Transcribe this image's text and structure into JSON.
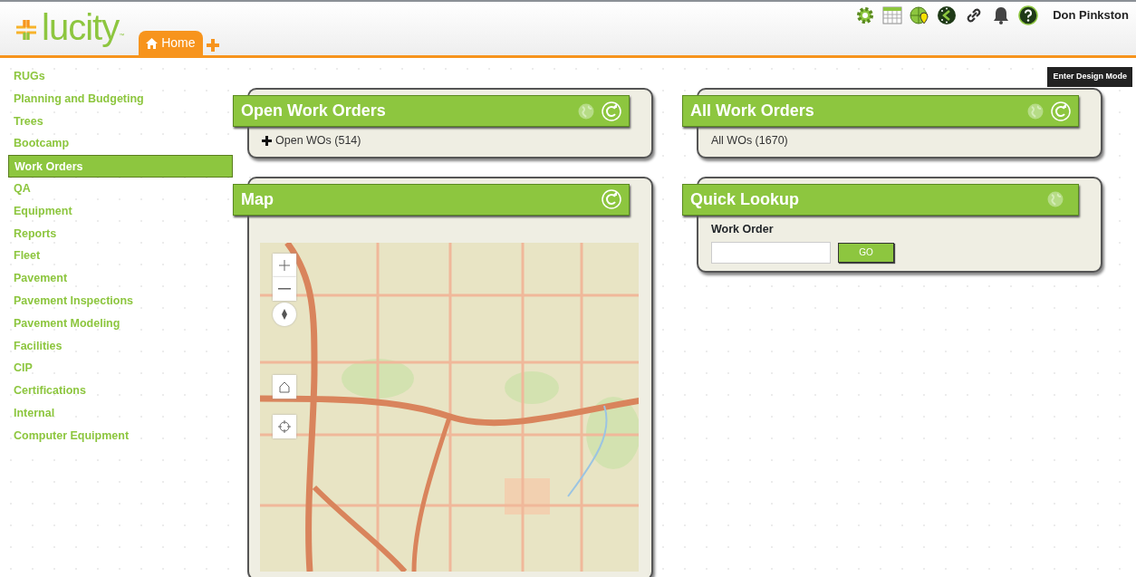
{
  "header": {
    "logo": "lucity",
    "logo_mark": "™",
    "tabs": [
      {
        "label": "Home",
        "selected": true
      }
    ],
    "user": "Don Pinkston",
    "tooltip": "Enter Design Mode"
  },
  "sidebar": {
    "items": [
      {
        "label": "RUGs",
        "selected": false
      },
      {
        "label": "Planning and Budgeting",
        "selected": false
      },
      {
        "label": "Trees",
        "selected": false
      },
      {
        "label": "Bootcamp",
        "selected": false
      },
      {
        "label": "Work Orders",
        "selected": true
      },
      {
        "label": "QA",
        "selected": false
      },
      {
        "label": "Equipment",
        "selected": false
      },
      {
        "label": "Reports",
        "selected": false
      },
      {
        "label": "Fleet",
        "selected": false
      },
      {
        "label": "Pavement",
        "selected": false
      },
      {
        "label": "Pavement Inspections",
        "selected": false
      },
      {
        "label": "Pavement Modeling",
        "selected": false
      },
      {
        "label": "Facilities",
        "selected": false
      },
      {
        "label": "CIP",
        "selected": false
      },
      {
        "label": "Certifications",
        "selected": false
      },
      {
        "label": "Internal",
        "selected": false
      },
      {
        "label": "Computer Equipment",
        "selected": false
      }
    ]
  },
  "columns": [
    [
      {
        "kind": "list",
        "title": "Open Work Orders",
        "globe": true,
        "refresh": true,
        "items": [
          {
            "label": "Open WOs (514)",
            "expandable": true
          }
        ]
      },
      {
        "kind": "map",
        "title": "Map",
        "globe": false,
        "refresh": true
      }
    ],
    [
      {
        "kind": "list",
        "title": "All Work Orders",
        "globe": true,
        "refresh": true,
        "items": [
          {
            "label": "All WOs (1670)",
            "expandable": false
          }
        ]
      },
      {
        "kind": "lookup",
        "title": "Quick Lookup",
        "globe": true,
        "refresh": false,
        "field_label": "Work Order",
        "button": "GO"
      }
    ]
  ]
}
